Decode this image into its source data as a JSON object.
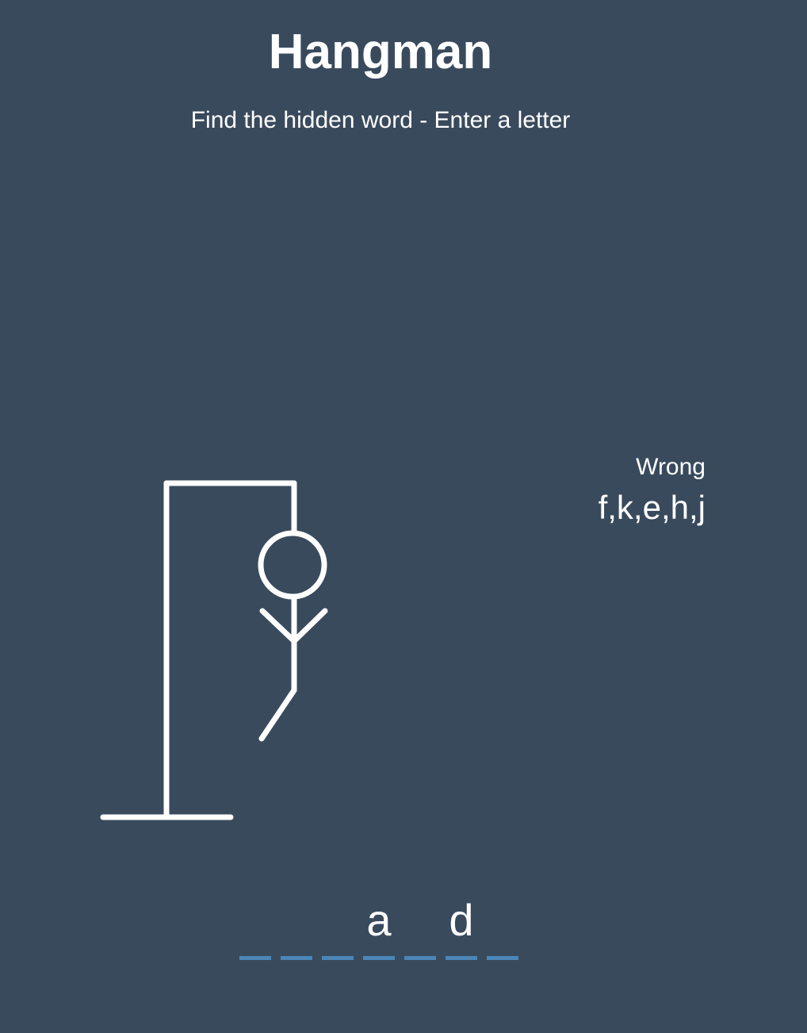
{
  "header": {
    "title": "Hangman",
    "subtitle": "Find the hidden word - Enter a letter"
  },
  "wrong": {
    "label": "Wrong",
    "letters": "f,k,e,h,j"
  },
  "word": {
    "slots": [
      "",
      "",
      "",
      "a",
      "",
      "d",
      ""
    ]
  },
  "hangman": {
    "parts_shown": [
      "base",
      "pole",
      "beam",
      "rope",
      "head",
      "body",
      "left-arm",
      "right-arm",
      "left-leg"
    ]
  },
  "colors": {
    "background": "#3a4a5d",
    "foreground": "#ffffff",
    "dash": "#4b86b8"
  }
}
